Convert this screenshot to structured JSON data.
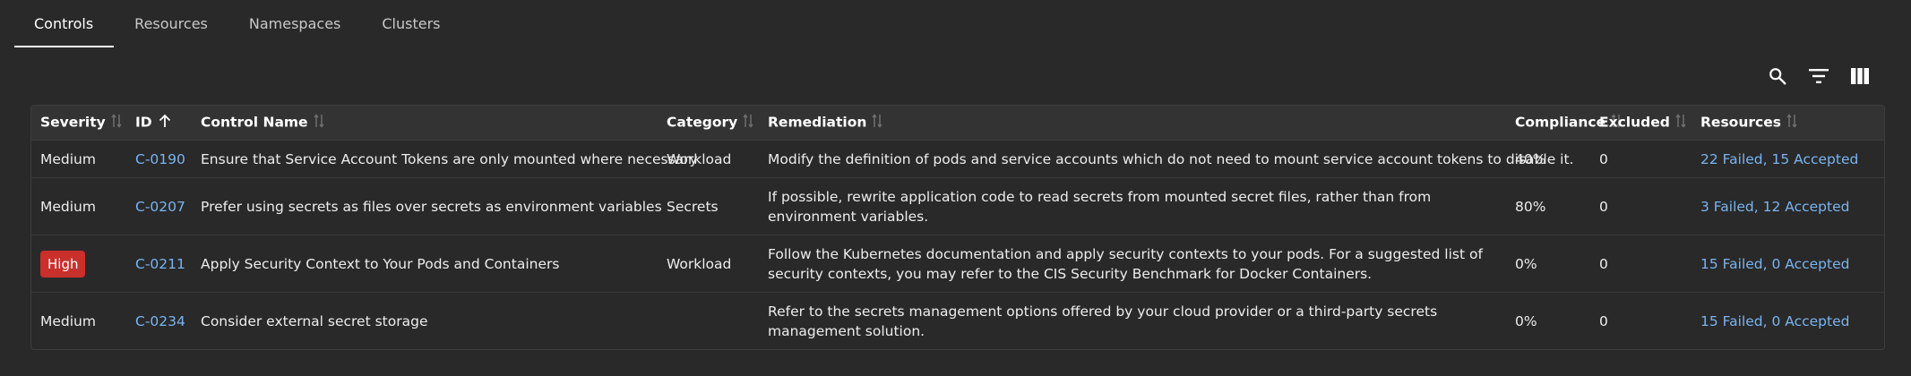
{
  "tabs": [
    {
      "label": "Controls",
      "active": true
    },
    {
      "label": "Resources",
      "active": false
    },
    {
      "label": "Namespaces",
      "active": false
    },
    {
      "label": "Clusters",
      "active": false
    }
  ],
  "toolbar": {
    "icons": [
      "search-icon",
      "filter-icon",
      "columns-icon"
    ]
  },
  "table": {
    "headers": {
      "severity": "Severity",
      "id": "ID",
      "control_name": "Control Name",
      "category": "Category",
      "remediation": "Remediation",
      "compliance": "Compliance",
      "excluded": "Excluded",
      "resources": "Resources"
    },
    "sort": {
      "column": "ID",
      "direction": "ascending"
    },
    "rows": [
      {
        "severity": "Medium",
        "id": "C-0190",
        "control_name": "Ensure that Service Account Tokens are only mounted where necessary",
        "category": "Workload",
        "remediation": "Modify the definition of pods and service accounts which do not need to mount service account tokens to disable it.",
        "compliance": "40%",
        "excluded": "0",
        "resources": "22 Failed, 15 Accepted"
      },
      {
        "severity": "Medium",
        "id": "C-0207",
        "control_name": "Prefer using secrets as files over secrets as environment variables",
        "category": "Secrets",
        "remediation": "If possible, rewrite application code to read secrets from mounted secret files, rather than from environment variables.",
        "compliance": "80%",
        "excluded": "0",
        "resources": "3 Failed, 12 Accepted"
      },
      {
        "severity": "High",
        "id": "C-0211",
        "control_name": "Apply Security Context to Your Pods and Containers",
        "category": "Workload",
        "remediation": "Follow the Kubernetes documentation and apply security contexts to your pods. For a suggested list of security contexts, you may refer to the CIS Security Benchmark for Docker Containers.",
        "compliance": "0%",
        "excluded": "0",
        "resources": "15 Failed, 0 Accepted"
      },
      {
        "severity": "Medium",
        "id": "C-0234",
        "control_name": "Consider external secret storage",
        "category": "",
        "remediation": "Refer to the secrets management options offered by your cloud provider or a third-party secrets management solution.",
        "compliance": "0%",
        "excluded": "0",
        "resources": "15 Failed, 0 Accepted"
      }
    ]
  },
  "colors": {
    "background": "#292929",
    "header_background": "#333333",
    "link": "#79b4f0",
    "badge_high": "#c9302c"
  }
}
